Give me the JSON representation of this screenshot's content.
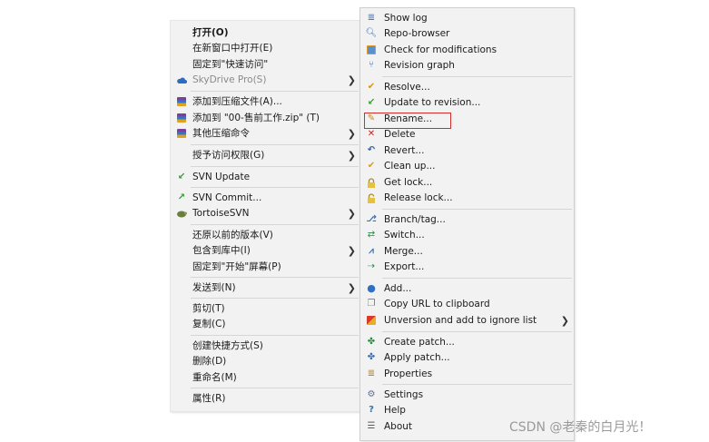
{
  "left_menu": {
    "items": [
      {
        "label": "打开(O)"
      },
      {
        "label": "在新窗口中打开(E)"
      },
      {
        "label": "固定到\"快速访问\""
      },
      {
        "label": "SkyDrive Pro(S)"
      },
      {
        "label": "添加到压缩文件(A)..."
      },
      {
        "label": "添加到 \"00-售前工作.zip\" (T)"
      },
      {
        "label": "其他压缩命令"
      },
      {
        "label": "授予访问权限(G)"
      },
      {
        "label": "SVN Update"
      },
      {
        "label": "SVN Commit..."
      },
      {
        "label": "TortoiseSVN"
      },
      {
        "label": "还原以前的版本(V)"
      },
      {
        "label": "包含到库中(I)"
      },
      {
        "label": "固定到\"开始\"屏幕(P)"
      },
      {
        "label": "发送到(N)"
      },
      {
        "label": "剪切(T)"
      },
      {
        "label": "复制(C)"
      },
      {
        "label": "创建快捷方式(S)"
      },
      {
        "label": "删除(D)"
      },
      {
        "label": "重命名(M)"
      },
      {
        "label": "属性(R)"
      }
    ]
  },
  "right_menu": {
    "items": [
      {
        "label": "Show log"
      },
      {
        "label": "Repo-browser"
      },
      {
        "label": "Check for modifications"
      },
      {
        "label": "Revision graph"
      },
      {
        "label": "Resolve..."
      },
      {
        "label": "Update to revision..."
      },
      {
        "label": "Rename..."
      },
      {
        "label": "Delete"
      },
      {
        "label": "Revert..."
      },
      {
        "label": "Clean up..."
      },
      {
        "label": "Get lock..."
      },
      {
        "label": "Release lock..."
      },
      {
        "label": "Branch/tag..."
      },
      {
        "label": "Switch..."
      },
      {
        "label": "Merge..."
      },
      {
        "label": "Export..."
      },
      {
        "label": "Add..."
      },
      {
        "label": "Copy URL to clipboard"
      },
      {
        "label": "Unversion and add to ignore list"
      },
      {
        "label": "Create patch..."
      },
      {
        "label": "Apply patch..."
      },
      {
        "label": "Properties"
      },
      {
        "label": "Settings"
      },
      {
        "label": "Help"
      },
      {
        "label": "About"
      }
    ]
  },
  "watermark": "CSDN @老秦的白月光！",
  "colors": {
    "highlight": "#d22d2d",
    "menu_bg": "#f2f2f2"
  }
}
